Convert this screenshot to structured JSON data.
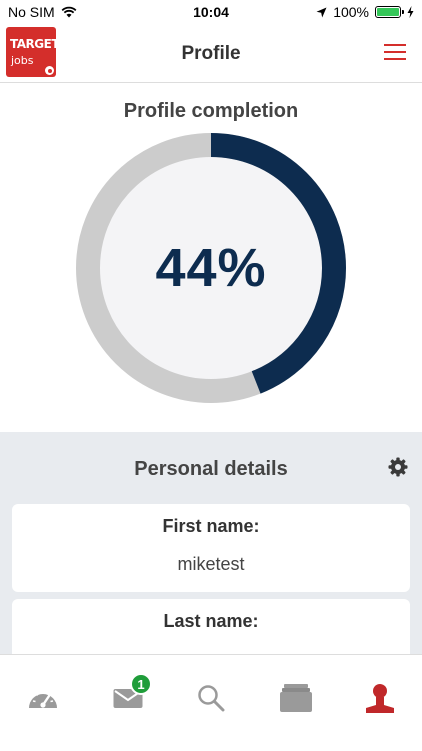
{
  "status_bar": {
    "carrier": "No SIM",
    "time": "10:04",
    "battery": "100%"
  },
  "header": {
    "logo_line1": "TARGET",
    "logo_line2": "jobs",
    "title": "Profile"
  },
  "completion": {
    "title": "Profile completion",
    "percent_label": "44%",
    "percent_value": 44,
    "colors": {
      "progress": "#0d2c4f",
      "track": "#cccccc",
      "inner": "#f4f4f6"
    }
  },
  "personal_details": {
    "title": "Personal details",
    "fields": [
      {
        "label": "First name:",
        "value": "miketest"
      },
      {
        "label": "Last name:",
        "value": ""
      }
    ]
  },
  "tabbar": {
    "items": [
      {
        "icon": "dashboard-gauge-icon"
      },
      {
        "icon": "messages-envelope-icon",
        "badge": "1"
      },
      {
        "icon": "search-icon"
      },
      {
        "icon": "cards-stack-icon"
      },
      {
        "icon": "profile-person-icon",
        "active": true
      }
    ],
    "colors": {
      "inactive": "#9a9a9a",
      "active": "#c0282a",
      "badge": "#1f9d3a"
    }
  }
}
